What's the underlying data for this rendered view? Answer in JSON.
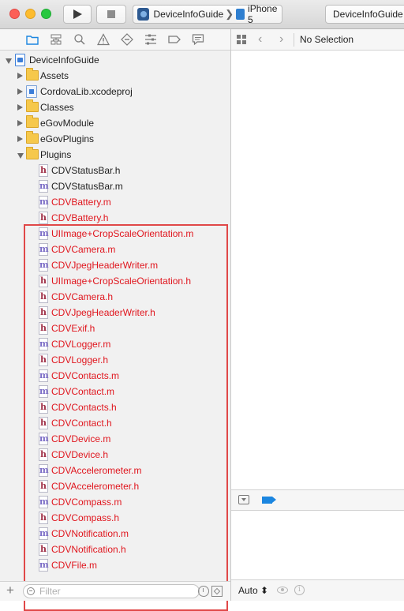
{
  "toolbar": {
    "scheme_name": "DeviceInfoGuide",
    "scheme_separator": "❯",
    "device_name": "iPhone 5",
    "activity_text": "DeviceInfoGuide"
  },
  "navigator": {
    "tabs": [
      "folder-icon",
      "hierarchy-icon",
      "search-icon",
      "warning-icon",
      "test-diamond-icon",
      "debug-icon",
      "breakpoint-icon",
      "report-icon"
    ],
    "tree": [
      {
        "label": "DeviceInfoGuide",
        "icon": "project-icon",
        "level": 0,
        "disclosure": "open",
        "highlighted": false
      },
      {
        "label": "Assets",
        "icon": "folder-icon",
        "level": 1,
        "disclosure": "closed",
        "highlighted": false
      },
      {
        "label": "CordovaLib.xcodeproj",
        "icon": "xcodeproj-icon",
        "level": 1,
        "disclosure": "closed",
        "highlighted": false
      },
      {
        "label": "Classes",
        "icon": "folder-icon",
        "level": 1,
        "disclosure": "closed",
        "highlighted": false
      },
      {
        "label": "eGovModule",
        "icon": "folder-icon",
        "level": 1,
        "disclosure": "closed",
        "highlighted": false
      },
      {
        "label": "eGovPlugins",
        "icon": "folder-icon",
        "level": 1,
        "disclosure": "closed",
        "highlighted": false
      },
      {
        "label": "Plugins",
        "icon": "folder-icon",
        "level": 1,
        "disclosure": "open",
        "highlighted": false
      },
      {
        "label": "CDVStatusBar.h",
        "icon": "h",
        "level": 2,
        "highlighted": false
      },
      {
        "label": "CDVStatusBar.m",
        "icon": "m",
        "level": 2,
        "highlighted": false
      },
      {
        "label": "CDVBattery.m",
        "icon": "m",
        "level": 2,
        "highlighted": true
      },
      {
        "label": "CDVBattery.h",
        "icon": "h",
        "level": 2,
        "highlighted": true
      },
      {
        "label": "UIImage+CropScaleOrientation.m",
        "icon": "m",
        "level": 2,
        "highlighted": true
      },
      {
        "label": "CDVCamera.m",
        "icon": "m",
        "level": 2,
        "highlighted": true
      },
      {
        "label": "CDVJpegHeaderWriter.m",
        "icon": "m",
        "level": 2,
        "highlighted": true
      },
      {
        "label": "UIImage+CropScaleOrientation.h",
        "icon": "h",
        "level": 2,
        "highlighted": true
      },
      {
        "label": "CDVCamera.h",
        "icon": "h",
        "level": 2,
        "highlighted": true
      },
      {
        "label": "CDVJpegHeaderWriter.h",
        "icon": "h",
        "level": 2,
        "highlighted": true
      },
      {
        "label": "CDVExif.h",
        "icon": "h",
        "level": 2,
        "highlighted": true
      },
      {
        "label": "CDVLogger.m",
        "icon": "m",
        "level": 2,
        "highlighted": true
      },
      {
        "label": "CDVLogger.h",
        "icon": "h",
        "level": 2,
        "highlighted": true
      },
      {
        "label": "CDVContacts.m",
        "icon": "m",
        "level": 2,
        "highlighted": true
      },
      {
        "label": "CDVContact.m",
        "icon": "m",
        "level": 2,
        "highlighted": true
      },
      {
        "label": "CDVContacts.h",
        "icon": "h",
        "level": 2,
        "highlighted": true
      },
      {
        "label": "CDVContact.h",
        "icon": "h",
        "level": 2,
        "highlighted": true
      },
      {
        "label": "CDVDevice.m",
        "icon": "m",
        "level": 2,
        "highlighted": true
      },
      {
        "label": "CDVDevice.h",
        "icon": "h",
        "level": 2,
        "highlighted": true
      },
      {
        "label": "CDVAccelerometer.m",
        "icon": "m",
        "level": 2,
        "highlighted": true
      },
      {
        "label": "CDVAccelerometer.h",
        "icon": "h",
        "level": 2,
        "highlighted": true
      },
      {
        "label": "CDVCompass.m",
        "icon": "m",
        "level": 2,
        "highlighted": true
      },
      {
        "label": "CDVCompass.h",
        "icon": "h",
        "level": 2,
        "highlighted": true
      },
      {
        "label": "CDVNotification.m",
        "icon": "m",
        "level": 2,
        "highlighted": true
      },
      {
        "label": "CDVNotification.h",
        "icon": "h",
        "level": 2,
        "highlighted": true
      },
      {
        "label": "CDVFile.m",
        "icon": "m",
        "level": 2,
        "highlighted": true
      }
    ],
    "filter_placeholder": "Filter"
  },
  "editor": {
    "no_selection_label": "No Selection"
  },
  "console": {
    "auto_label": "Auto ⬍",
    "info_glyph": "i"
  },
  "colors": {
    "highlight_text": "#e0161e",
    "highlight_border": "#e04848",
    "m_file": "#7b6cc6",
    "h_file": "#a1334a"
  }
}
